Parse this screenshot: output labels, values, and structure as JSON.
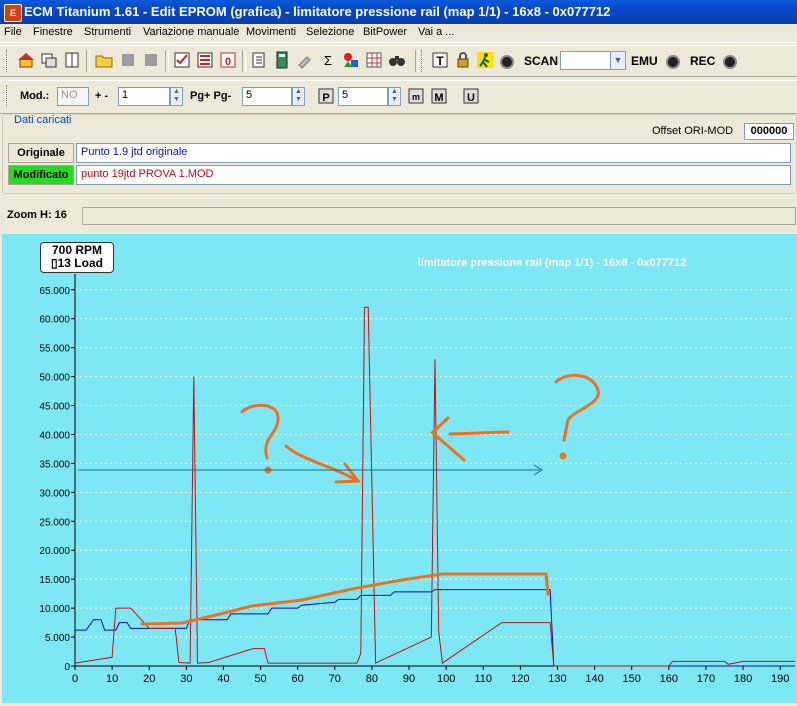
{
  "window": {
    "title": "ECM Titanium 1.61 - Edit EPROM (grafica) - limitatore pressione rail (map 1/1) - 16x8 - 0x077712",
    "app_icon": "ecm-icon"
  },
  "menu": [
    "File",
    "Finestre",
    "Strumenti",
    "Variazione manuale",
    "Movimenti",
    "Selezione",
    "BitPower",
    "Vai a ..."
  ],
  "toolbar1": {
    "buttons": [
      "home-icon",
      "windows-icon",
      "panel-icon",
      "open-folder-icon",
      "disabled-icon",
      "disabled-icon",
      "checklist-icon",
      "checklist2-icon",
      "zero-icon",
      "export-icon",
      "calculator-icon",
      "tool-icon",
      "sum-icon",
      "colors-icon",
      "grid-icon",
      "binoculars-icon"
    ],
    "right_buttons": [
      "text-icon",
      "lock-icon",
      "runner-icon",
      "record-dot-icon"
    ],
    "scan_label": "SCAN",
    "emu_label": "EMU",
    "rec_label": "REC",
    "scan_value": ""
  },
  "toolbar2": {
    "mod_label": "Mod.:",
    "mod_value": "NO",
    "plusminus_label": "+ -",
    "plusminus_value": "1",
    "page_label": "Pg+ Pg-",
    "page_value": "5",
    "p_value": "5",
    "buttons": [
      "p-icon",
      "m-small-icon",
      "m-icon",
      "u-icon"
    ]
  },
  "dati": {
    "title": "Dati caricati",
    "offset_label": "Offset ORI-MOD",
    "offset_value": "000000",
    "originale_label": "Originale",
    "originale_value": "Punto 1.9 jtd originale",
    "modificato_label": "Modificato",
    "modificato_value": "punto 19jtd PROVA 1.MOD"
  },
  "zoom": {
    "label": "Zoom H: 16"
  },
  "chart_info": {
    "line1": "700 RPM",
    "line2": "13 Load"
  },
  "colors": {
    "chart_bg": "#7de8f3",
    "original": "#0b0bb5",
    "modified": "#c01010",
    "annotation": "#f07020",
    "modificato_badge": "#22dd22"
  },
  "chart_data": {
    "type": "line",
    "title": "limitatore pressione rail (map 1/1) - 16x8 - 0x077712",
    "xlim": [
      0,
      194
    ],
    "ylim": [
      0,
      66000
    ],
    "xticks": [
      0,
      10,
      20,
      30,
      40,
      50,
      60,
      70,
      80,
      90,
      100,
      110,
      120,
      130,
      140,
      150,
      160,
      170,
      180,
      190
    ],
    "yticks": [
      0,
      5000,
      10000,
      15000,
      20000,
      25000,
      30000,
      35000,
      40000,
      45000,
      50000,
      55000,
      60000,
      65000
    ],
    "ytick_labels": [
      "0",
      "5.000",
      "10.000",
      "15.000",
      "20.000",
      "25.000",
      "30.000",
      "35.000",
      "40.000",
      "45.000",
      "50.000",
      "55.000",
      "60.000",
      "65.000"
    ],
    "series": [
      {
        "points": [
          [
            0,
            6200
          ],
          [
            3,
            6200
          ],
          [
            5,
            8000
          ],
          [
            7,
            8000
          ],
          [
            8,
            6200
          ],
          [
            11,
            6200
          ],
          [
            12,
            7500
          ],
          [
            14,
            7500
          ],
          [
            15,
            6500
          ],
          [
            30,
            6500
          ],
          [
            31,
            8000
          ],
          [
            41,
            8000
          ],
          [
            42,
            9000
          ],
          [
            52,
            9000
          ],
          [
            53,
            10000
          ],
          [
            60,
            10000
          ],
          [
            61,
            10500
          ],
          [
            70,
            11000
          ],
          [
            71,
            11500
          ],
          [
            76,
            11500
          ],
          [
            77,
            12200
          ],
          [
            85,
            12200
          ],
          [
            86,
            12800
          ],
          [
            96,
            12800
          ],
          [
            97,
            13200
          ],
          [
            128,
            13200
          ],
          [
            129,
            0
          ],
          [
            194,
            0
          ]
        ]
      },
      {
        "points": [
          [
            0,
            500
          ],
          [
            10,
            1500
          ],
          [
            11,
            10000
          ],
          [
            15,
            10000
          ],
          [
            20,
            6500
          ],
          [
            27,
            6500
          ],
          [
            28,
            600
          ],
          [
            31,
            500
          ],
          [
            32,
            50000
          ],
          [
            33,
            500
          ],
          [
            36,
            600
          ],
          [
            48,
            3000
          ],
          [
            51,
            3000
          ],
          [
            52,
            500
          ],
          [
            76,
            500
          ],
          [
            77,
            2200
          ],
          [
            78,
            62000
          ],
          [
            79,
            62000
          ],
          [
            81,
            500
          ],
          [
            96,
            5000
          ],
          [
            97,
            53000
          ],
          [
            98,
            6000
          ],
          [
            99,
            500
          ],
          [
            115,
            7500
          ],
          [
            128,
            7500
          ],
          [
            129,
            0
          ],
          [
            160,
            0
          ],
          [
            161,
            800
          ],
          [
            175,
            800
          ],
          [
            176,
            300
          ],
          [
            180,
            800
          ],
          [
            194,
            800
          ]
        ]
      }
    ]
  }
}
